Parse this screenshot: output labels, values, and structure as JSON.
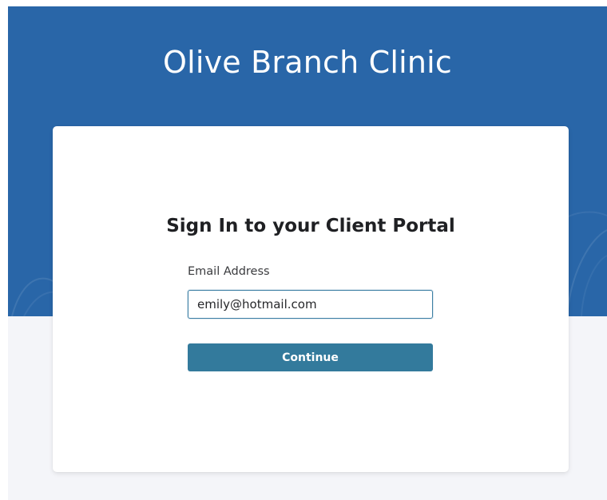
{
  "header": {
    "clinic_name": "Olive Branch Clinic"
  },
  "signin": {
    "title": "Sign In to your Client Portal",
    "email_label": "Email Address",
    "email_value": "emily@hotmail.com",
    "continue_label": "Continue"
  },
  "colors": {
    "hero_background": "#2966a8",
    "button_background": "#337a9c",
    "input_border": "#3d7fa4",
    "page_background": "#f4f5f9"
  }
}
